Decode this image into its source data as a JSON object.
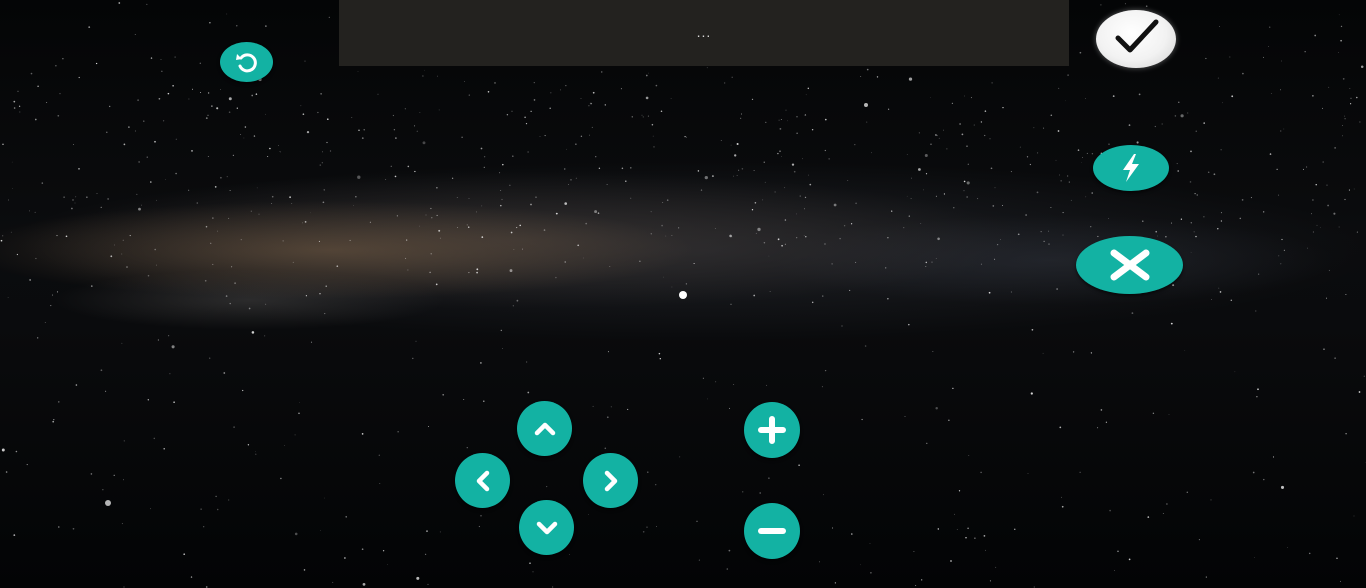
{
  "top_bar": {
    "text": "..."
  },
  "icons": {
    "reset": "rotate-ccw-icon",
    "confirm": "checkmark-icon",
    "flash": "lightning-icon",
    "close": "close-x-icon",
    "up": "chevron-up-icon",
    "down": "chevron-down-icon",
    "left": "chevron-left-icon",
    "right": "chevron-right-icon",
    "zoom_in": "plus-icon",
    "zoom_out": "minus-icon",
    "center": "center-dot"
  },
  "colors": {
    "button": "#13b2a3",
    "button_icon": "#ffffff",
    "top_bar": "#23221f",
    "confirm": "#f2f2f2"
  }
}
